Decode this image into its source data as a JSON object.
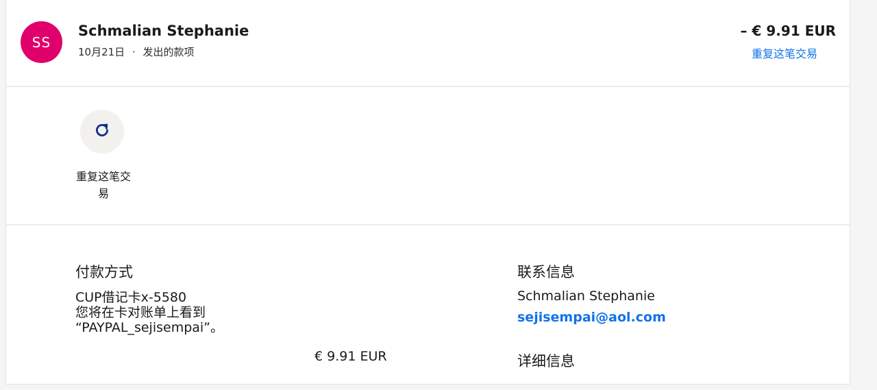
{
  "header": {
    "avatar_initials": "SS",
    "avatar_color": "#e0006b",
    "name": "Schmalian Stephanie",
    "date": "10月21日",
    "separator": "·",
    "type": "发出的款项",
    "amount": "– € 9.91 EUR",
    "repeat_link": "重复这笔交易"
  },
  "actions": {
    "repeat": {
      "icon": "refresh-icon",
      "label_line1": "重复这笔交",
      "label_line2": "易"
    }
  },
  "payment_method": {
    "title": "付款方式",
    "card": "CUP借记卡x-5580",
    "statement_line1": "您将在卡对账单上看到",
    "statement_line2": "“PAYPAL_sejisempai”。",
    "amount": "€ 9.91 EUR"
  },
  "contact": {
    "title": "联系信息",
    "name": "Schmalian Stephanie",
    "email": "sejisempai@aol.com"
  },
  "details": {
    "title": "详细信息"
  },
  "colors": {
    "link": "#1072eb",
    "avatar": "#e0006b"
  }
}
